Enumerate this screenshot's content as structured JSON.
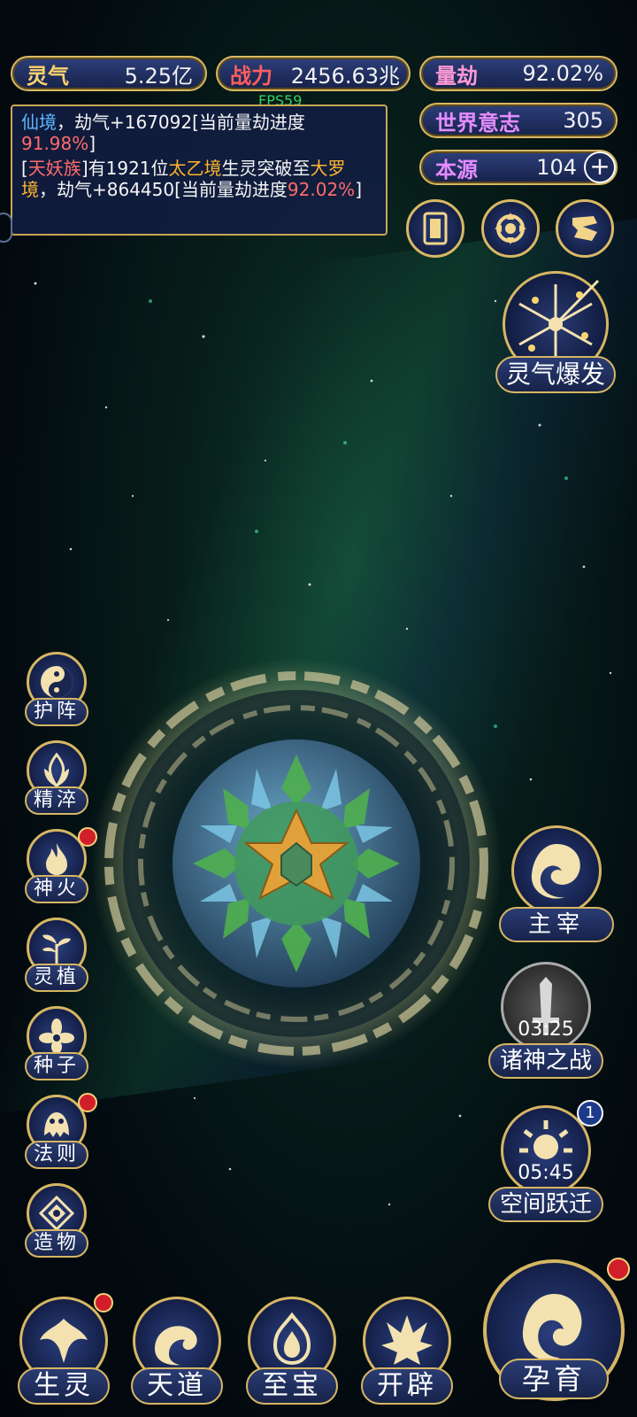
{
  "top_bar": {
    "lingqi": {
      "label": "灵气",
      "value": "5.25亿"
    },
    "zhanli": {
      "label": "战力",
      "value": "2456.63兆"
    },
    "liangjie": {
      "label": "量劫",
      "value": "92.02%"
    },
    "shijie_yizhi": {
      "label": "世界意志",
      "value": "305"
    },
    "benyuan": {
      "label": "本源",
      "value": "104"
    }
  },
  "fps": "FPS59",
  "log": {
    "entry1": {
      "realm": "仙境",
      "text1": "，劫气+167092[当前量劫进度",
      "progress": "91.98%",
      "close": "]"
    },
    "entry2": {
      "open": "[",
      "faction": "天妖族",
      "text1": "]有1921位",
      "realm_from": "太乙境",
      "text2": "生灵突破至",
      "realm_to": "大罗境",
      "text3": "，劫气+864450[当前量劫进度",
      "progress": "92.02%",
      "close": "]"
    }
  },
  "burst_button": {
    "label": "灵气爆发"
  },
  "left_menu": [
    {
      "label": "护阵",
      "badge": false
    },
    {
      "label": "精淬",
      "badge": false
    },
    {
      "label": "神火",
      "badge": true
    },
    {
      "label": "灵植",
      "badge": false
    },
    {
      "label": "种子",
      "badge": false
    },
    {
      "label": "法则",
      "badge": true
    },
    {
      "label": "造物",
      "badge": false
    }
  ],
  "right_menu": {
    "zhuzai": {
      "label": "主宰"
    },
    "zhushen": {
      "label": "诸神之战",
      "timer": "03:25"
    },
    "kongjian": {
      "label": "空间跃迁",
      "timer": "05:45",
      "count": "1"
    }
  },
  "bottom_menu": [
    {
      "label": "生灵",
      "badge": true
    },
    {
      "label": "天道",
      "badge": false
    },
    {
      "label": "至宝",
      "badge": false
    },
    {
      "label": "开辟",
      "badge": false
    }
  ],
  "main_button": {
    "label": "孕育",
    "badge": true
  },
  "colors": {
    "gold_border": "#d9b865",
    "panel_blue": "#16224a",
    "badge_red": "#d21e2b",
    "progress_red": "#ff6b6b",
    "realm_blue": "#5fb8ff",
    "realm_gold": "#ffb52e"
  }
}
